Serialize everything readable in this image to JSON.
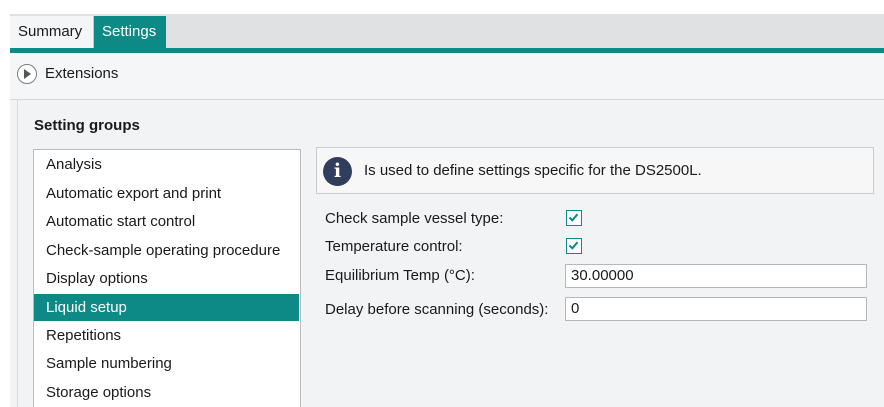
{
  "tabs": [
    {
      "label": "Summary",
      "active": false
    },
    {
      "label": "Settings",
      "active": true
    }
  ],
  "extensions": {
    "label": "Extensions",
    "icon": "expand-arrow-icon"
  },
  "setting_groups": {
    "title": "Setting groups",
    "items": [
      {
        "label": "Analysis"
      },
      {
        "label": "Automatic export and print"
      },
      {
        "label": "Automatic start control"
      },
      {
        "label": "Check-sample operating procedure"
      },
      {
        "label": "Display options"
      },
      {
        "label": "Liquid setup",
        "selected": true
      },
      {
        "label": "Repetitions"
      },
      {
        "label": "Sample numbering"
      },
      {
        "label": "Storage options"
      }
    ]
  },
  "info": {
    "icon": "info-icon",
    "text": "Is used to define settings specific for the DS2500L."
  },
  "fields": {
    "check_vessel": {
      "label": "Check sample vessel type:",
      "checked": true
    },
    "temp_control": {
      "label": "Temperature control:",
      "checked": true
    },
    "equilibrium_temp": {
      "label": "Equilibrium Temp (°C):",
      "value": "30.00000"
    },
    "delay_scanning": {
      "label": "Delay before scanning (seconds):",
      "value": "0"
    }
  },
  "colors": {
    "accent": "#0e8a86",
    "info_icon": "#2f3e5a"
  }
}
